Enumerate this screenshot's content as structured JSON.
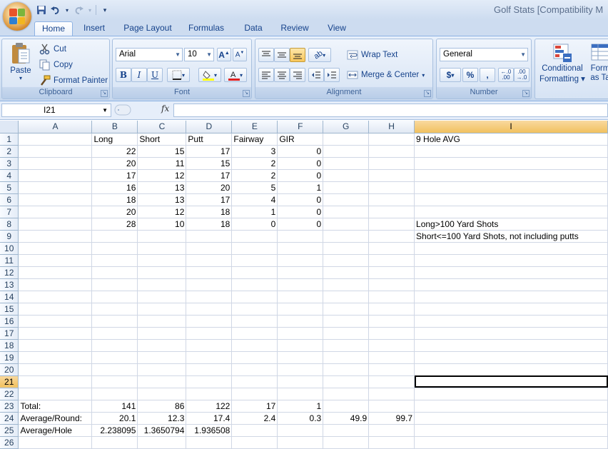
{
  "window": {
    "title": "Golf Stats  [Compatibility M"
  },
  "qat": {
    "save": "save-icon",
    "undo": "undo-icon",
    "redo": "redo-icon",
    "customize": "customize-arrow-icon"
  },
  "tabs": [
    {
      "label": "Home"
    },
    {
      "label": "Insert"
    },
    {
      "label": "Page Layout"
    },
    {
      "label": "Formulas"
    },
    {
      "label": "Data"
    },
    {
      "label": "Review"
    },
    {
      "label": "View"
    }
  ],
  "ribbon": {
    "clipboard": {
      "label": "Clipboard",
      "paste": "Paste",
      "cut": "Cut",
      "copy": "Copy",
      "format_painter": "Format Painter"
    },
    "font": {
      "label": "Font",
      "font_name": "Arial",
      "font_size": "10",
      "bold": "B",
      "italic": "I",
      "underline": "U"
    },
    "alignment": {
      "label": "Alignment",
      "wrap_text": "Wrap Text",
      "merge_center": "Merge & Center"
    },
    "number": {
      "label": "Number",
      "format": "General",
      "currency": "$",
      "percent": "%",
      "comma": ","
    },
    "styles": {
      "conditional_line1": "Conditional",
      "conditional_line2": "Formatting",
      "format_table_line1": "Form",
      "format_table_line2": "as Ta"
    }
  },
  "formula_bar": {
    "name_box": "I21",
    "fx": "fx",
    "formula": ""
  },
  "columns": [
    "A",
    "B",
    "C",
    "D",
    "E",
    "F",
    "G",
    "H",
    "I"
  ],
  "selected": {
    "column": "I",
    "row": 21
  },
  "rows": [
    [
      "",
      "Long",
      "Short",
      "Putt",
      "Fairway",
      "GIR",
      "",
      "",
      "9 Hole AVG"
    ],
    [
      "",
      "22",
      "15",
      "17",
      "3",
      "0",
      "",
      "",
      ""
    ],
    [
      "",
      "20",
      "11",
      "15",
      "2",
      "0",
      "",
      "",
      ""
    ],
    [
      "",
      "17",
      "12",
      "17",
      "2",
      "0",
      "",
      "",
      ""
    ],
    [
      "",
      "16",
      "13",
      "20",
      "5",
      "1",
      "",
      "",
      ""
    ],
    [
      "",
      "18",
      "13",
      "17",
      "4",
      "0",
      "",
      "",
      ""
    ],
    [
      "",
      "20",
      "12",
      "18",
      "1",
      "0",
      "",
      "",
      ""
    ],
    [
      "",
      "28",
      "10",
      "18",
      "0",
      "0",
      "",
      "",
      "Long>100 Yard Shots"
    ],
    [
      "",
      "",
      "",
      "",
      "",
      "",
      "",
      "",
      "Short<=100 Yard Shots, not including putts"
    ],
    [
      "",
      "",
      "",
      "",
      "",
      "",
      "",
      "",
      ""
    ],
    [
      "",
      "",
      "",
      "",
      "",
      "",
      "",
      "",
      ""
    ],
    [
      "",
      "",
      "",
      "",
      "",
      "",
      "",
      "",
      ""
    ],
    [
      "",
      "",
      "",
      "",
      "",
      "",
      "",
      "",
      ""
    ],
    [
      "",
      "",
      "",
      "",
      "",
      "",
      "",
      "",
      ""
    ],
    [
      "",
      "",
      "",
      "",
      "",
      "",
      "",
      "",
      ""
    ],
    [
      "",
      "",
      "",
      "",
      "",
      "",
      "",
      "",
      ""
    ],
    [
      "",
      "",
      "",
      "",
      "",
      "",
      "",
      "",
      ""
    ],
    [
      "",
      "",
      "",
      "",
      "",
      "",
      "",
      "",
      ""
    ],
    [
      "",
      "",
      "",
      "",
      "",
      "",
      "",
      "",
      ""
    ],
    [
      "",
      "",
      "",
      "",
      "",
      "",
      "",
      "",
      ""
    ],
    [
      "",
      "",
      "",
      "",
      "",
      "",
      "",
      "",
      ""
    ],
    [
      "",
      "",
      "",
      "",
      "",
      "",
      "",
      "",
      ""
    ],
    [
      "Total:",
      "141",
      "86",
      "122",
      "17",
      "1",
      "",
      "",
      ""
    ],
    [
      "Average/Round:",
      "20.1",
      "12.3",
      "17.4",
      "2.4",
      "0.3",
      "49.9",
      "99.7",
      ""
    ],
    [
      "Average/Hole",
      "2.238095",
      "1.3650794",
      "1.936508",
      "",
      "",
      "",
      "",
      ""
    ],
    [
      "",
      "",
      "",
      "",
      "",
      "",
      "",
      "",
      ""
    ]
  ]
}
